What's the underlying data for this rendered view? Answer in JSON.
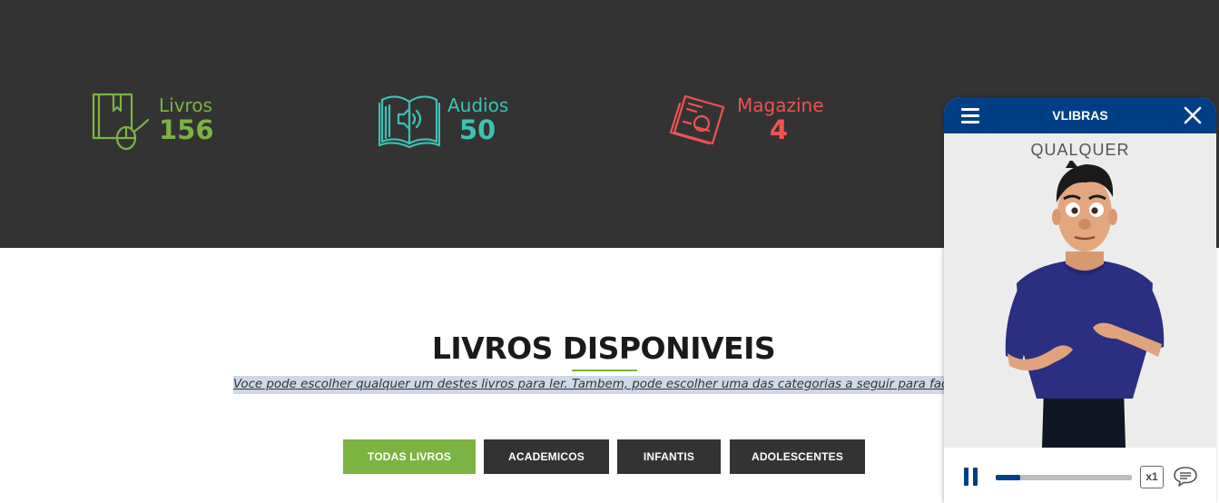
{
  "stats": [
    {
      "label": "Livros",
      "value": "156",
      "icon": "book-mouse-icon",
      "color": "#7cb342"
    },
    {
      "label": "Audios",
      "value": "50",
      "icon": "audio-book-icon",
      "color": "#3cc3b5"
    },
    {
      "label": "Magazine",
      "value": "4",
      "icon": "magazine-icon",
      "color": "#ef5350"
    }
  ],
  "section": {
    "title": "LIVROS DISPONIVEIS",
    "description": "Voce pode escolher qualquer um destes livros para ler. Tambem, pode escolher uma das categorias a seguir para facilitar sua b"
  },
  "filters": [
    {
      "label": "TODAS LIVROS",
      "active": true
    },
    {
      "label": "ACADEMICOS",
      "active": false
    },
    {
      "label": "INFANTIS",
      "active": false
    },
    {
      "label": "ADOLESCENTES",
      "active": false
    }
  ],
  "vlibras": {
    "title": "VLIBRAS",
    "current_word": "QUALQUER",
    "speed": "x1",
    "progress": 0.18,
    "header_color": "#003f86"
  },
  "colors": {
    "band": "#333333",
    "accent": "#7cb342"
  }
}
